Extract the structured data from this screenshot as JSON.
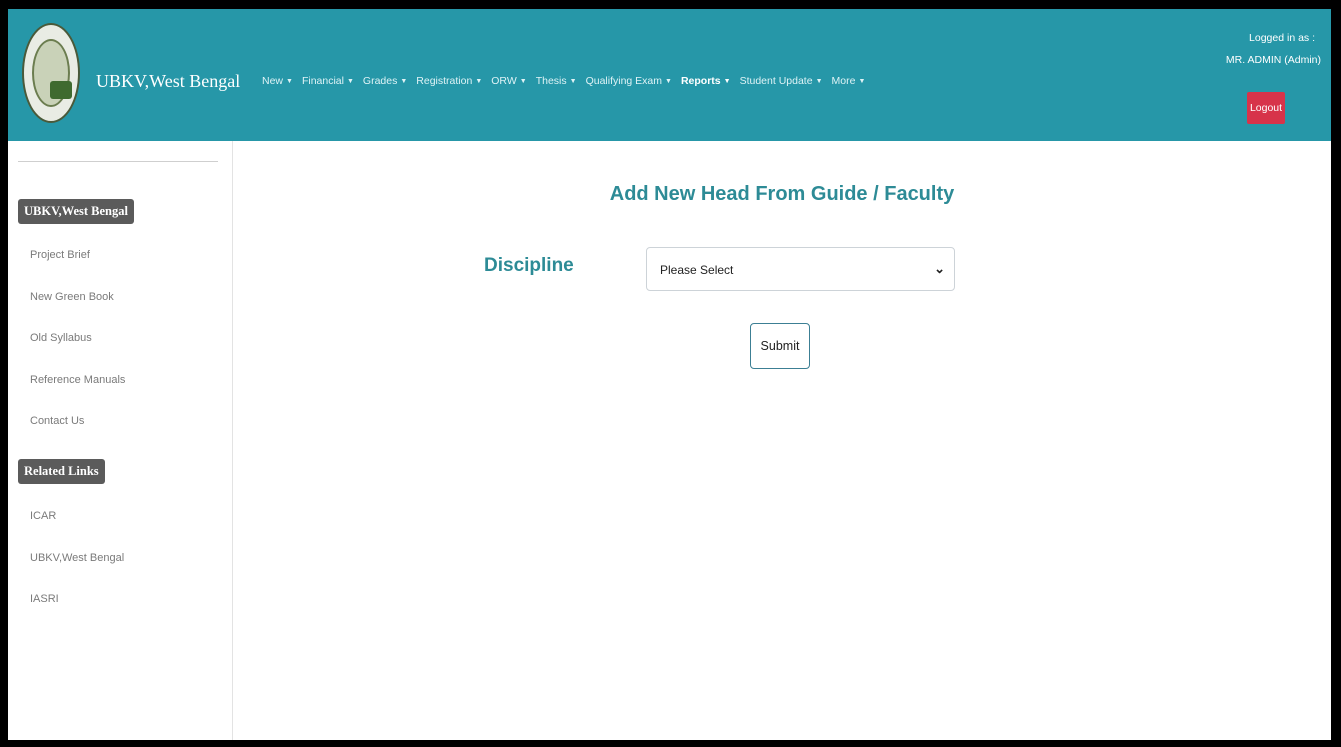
{
  "header": {
    "brand": "UBKV,West Bengal",
    "nav": [
      {
        "label": "New",
        "bold": false
      },
      {
        "label": "Financial",
        "bold": false
      },
      {
        "label": "Grades",
        "bold": false
      },
      {
        "label": "Registration",
        "bold": false
      },
      {
        "label": "ORW",
        "bold": false
      },
      {
        "label": "Thesis",
        "bold": false
      },
      {
        "label": "Qualifying Exam",
        "bold": false
      },
      {
        "label": "Reports",
        "bold": true
      },
      {
        "label": "Student Update",
        "bold": false
      },
      {
        "label": "More",
        "bold": false
      }
    ],
    "logged_in_label": "Logged in as :",
    "user_name": "MR. ADMIN (Admin)",
    "logout_label": "Logout"
  },
  "sidebar": {
    "section1_title": "UBKV,West Bengal",
    "section1_links": [
      "Project Brief",
      "New Green Book",
      "Old Syllabus",
      "Reference Manuals",
      "Contact Us"
    ],
    "section2_title": "Related Links",
    "section2_links": [
      "ICAR",
      "UBKV,West Bengal",
      "IASRI"
    ]
  },
  "main": {
    "title": "Add New Head From Guide / Faculty",
    "discipline_label": "Discipline",
    "discipline_value": "Please Select",
    "submit_label": "Submit"
  },
  "colors": {
    "header_bg": "#2697a8",
    "accent_text": "#2d8b96",
    "logout_bg": "#d7334a",
    "sidebar_heading_bg": "#5b5b5b"
  }
}
